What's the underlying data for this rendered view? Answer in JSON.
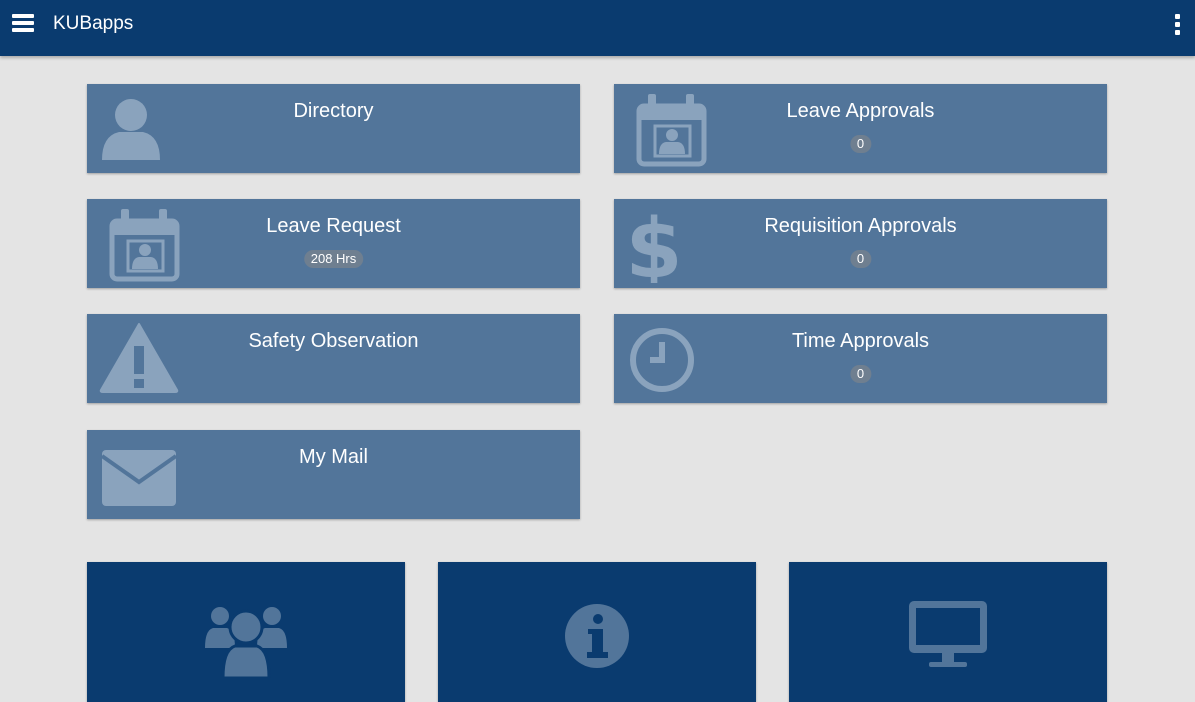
{
  "appbar": {
    "title": "KUBapps",
    "menu_icon": "hamburger-menu-icon",
    "overflow_icon": "more-vert-icon",
    "background_color": "#0a3b6f"
  },
  "tiles": [
    {
      "label": "Directory",
      "icon": "user-icon",
      "badge": null
    },
    {
      "label": "Leave Approvals",
      "icon": "calendar-user-icon",
      "badge": "0"
    },
    {
      "label": "Leave Request",
      "icon": "calendar-user-icon",
      "badge": "208 Hrs"
    },
    {
      "label": "Requisition Approvals",
      "icon": "dollar-icon",
      "badge": "0"
    },
    {
      "label": "Safety Observation",
      "icon": "warning-icon",
      "badge": null
    },
    {
      "label": "Time Approvals",
      "icon": "clock-icon",
      "badge": "0"
    },
    {
      "label": "My Mail",
      "icon": "envelope-icon",
      "badge": null
    }
  ],
  "bottom_tiles": [
    {
      "icon": "people-group-icon"
    },
    {
      "icon": "info-icon"
    },
    {
      "icon": "desktop-icon"
    }
  ],
  "colors": {
    "tile_background": "#52759a",
    "tile_icon": "#8aa3bd",
    "badge_background": "#6f7f90",
    "bottom_tile_background": "#0a3b6f",
    "bottom_tile_icon": "#52759a",
    "page_background": "#e4e4e4"
  }
}
